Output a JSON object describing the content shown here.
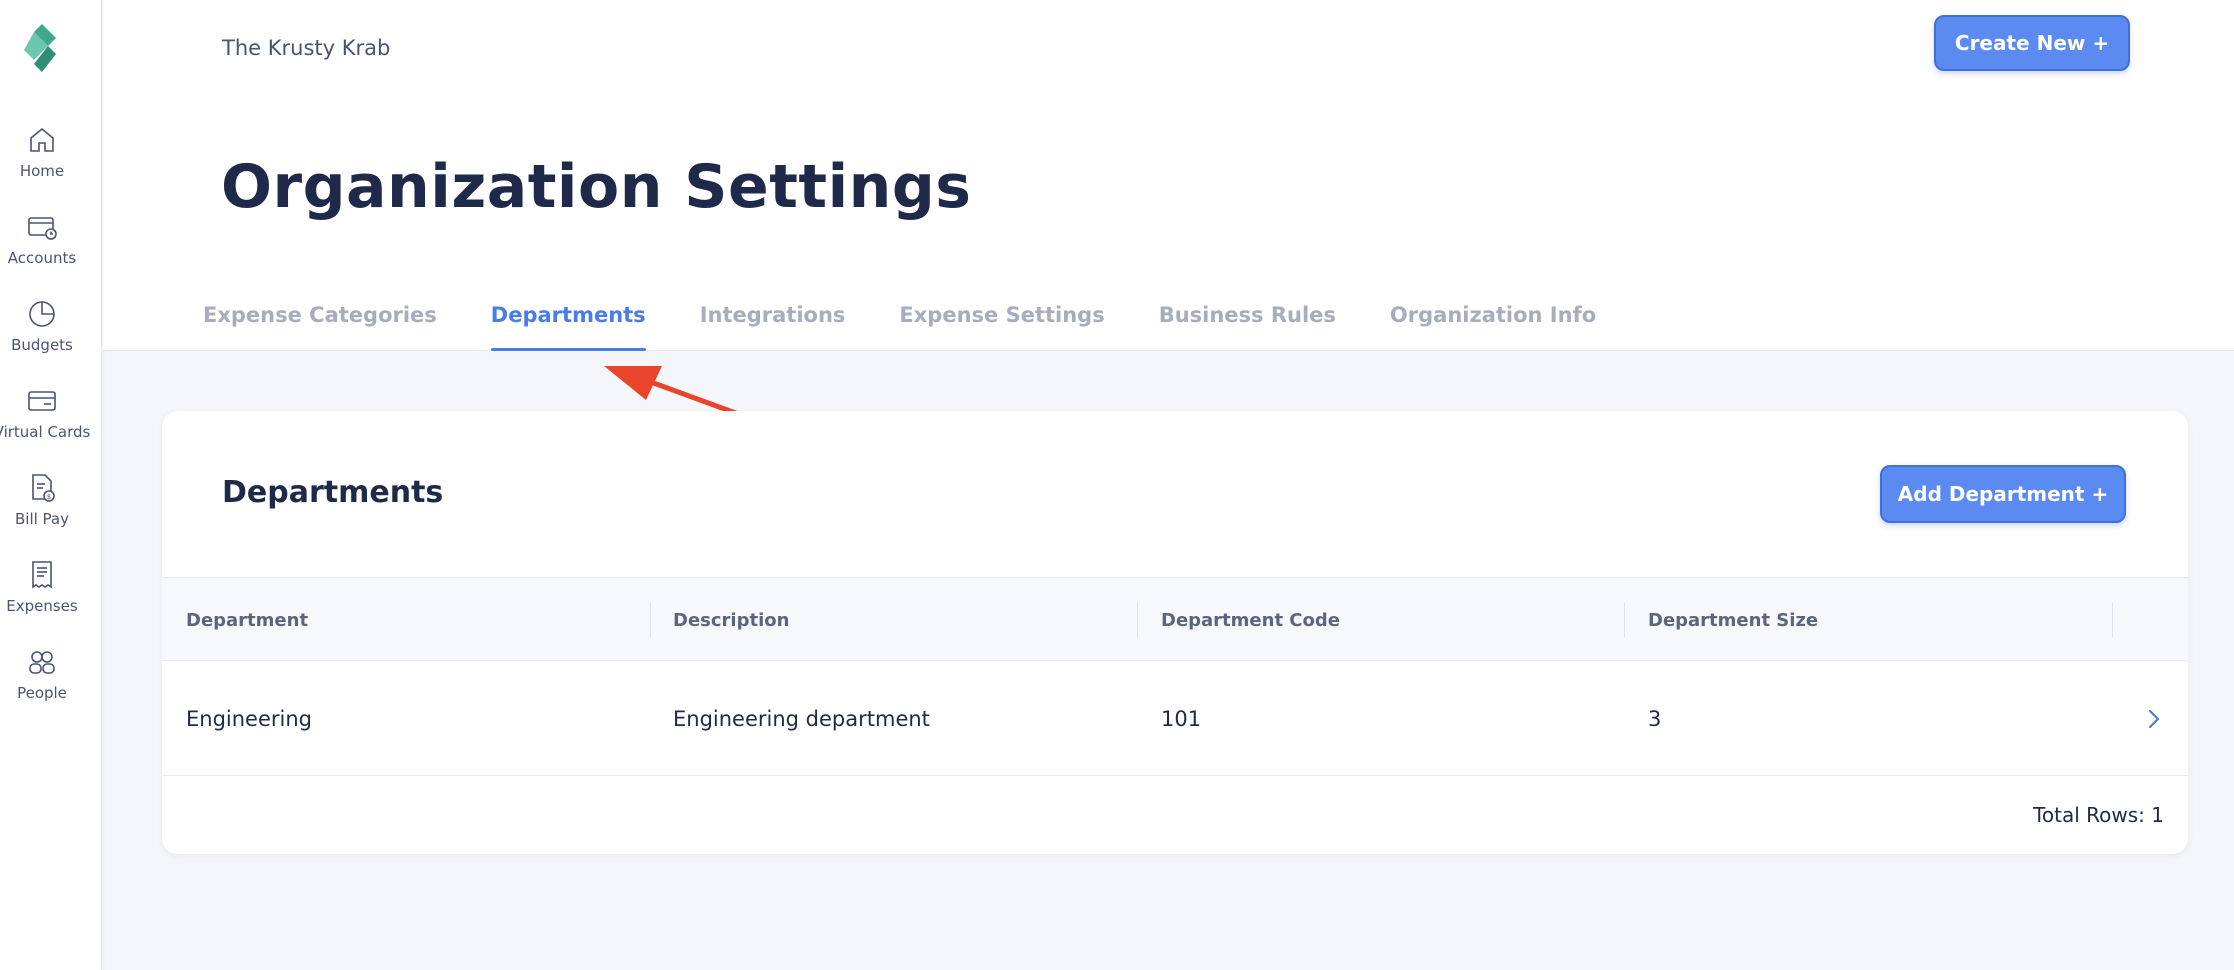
{
  "app": {
    "org_name": "The Krusty Krab",
    "create_label": "Create New +",
    "page_title": "Organization Settings"
  },
  "sidebar": {
    "items": [
      {
        "label": "Home",
        "icon": "home-icon"
      },
      {
        "label": "Accounts",
        "icon": "accounts-icon"
      },
      {
        "label": "Budgets",
        "icon": "pie-chart-icon"
      },
      {
        "label": "Virtual Cards",
        "icon": "card-icon"
      },
      {
        "label": "Bill Pay",
        "icon": "invoice-icon"
      },
      {
        "label": "Expenses",
        "icon": "receipt-icon"
      },
      {
        "label": "People",
        "icon": "people-icon"
      }
    ]
  },
  "tabs": [
    {
      "label": "Expense Categories",
      "active": false
    },
    {
      "label": "Departments",
      "active": true
    },
    {
      "label": "Integrations",
      "active": false
    },
    {
      "label": "Expense Settings",
      "active": false
    },
    {
      "label": "Business Rules",
      "active": false
    },
    {
      "label": "Organization Info",
      "active": false
    }
  ],
  "departments": {
    "title": "Departments",
    "add_label": "Add Department +",
    "columns": [
      "Department",
      "Description",
      "Department Code",
      "Department Size"
    ],
    "rows": [
      {
        "department": "Engineering",
        "description": "Engineering department",
        "code": "101",
        "size": "3"
      }
    ],
    "total_label": "Total Rows: 1"
  },
  "colors": {
    "accent": "#4a7ce8",
    "button": "#5b8af0",
    "annotation_arrow": "#e8452c"
  }
}
